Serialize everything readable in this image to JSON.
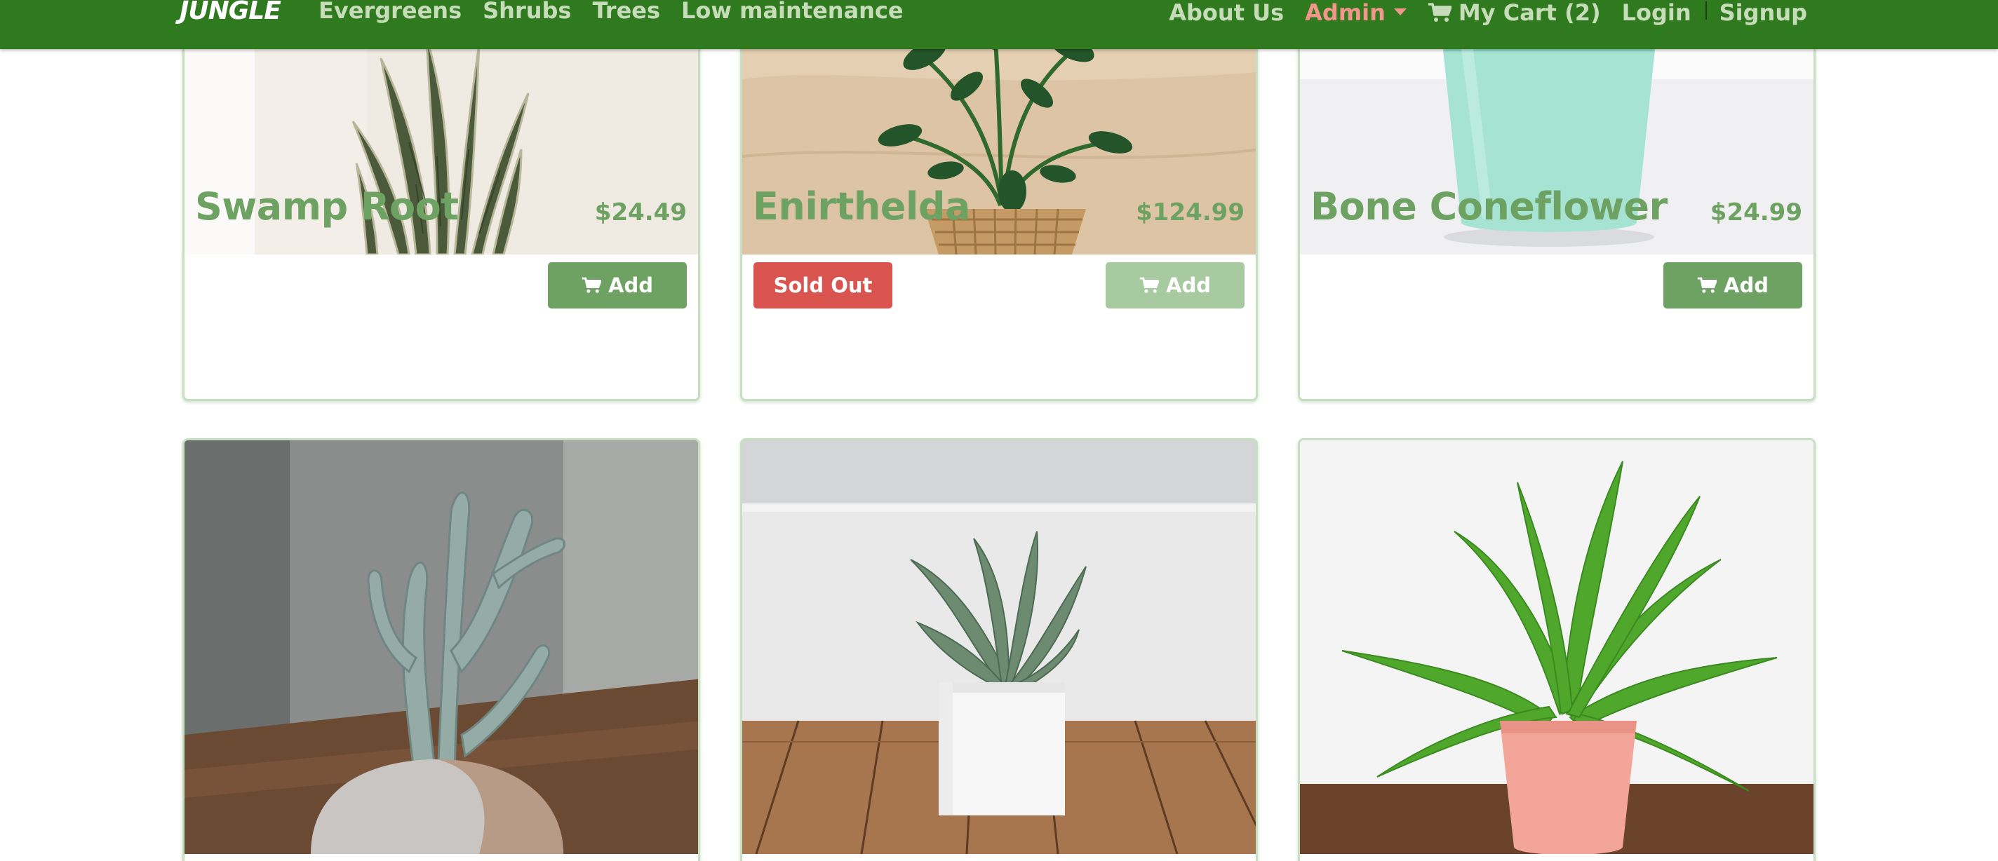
{
  "navbar": {
    "brand": "JUNGLE",
    "categories": [
      "Evergreens",
      "Shrubs",
      "Trees",
      "Low maintenance"
    ],
    "about": "About Us",
    "admin": "Admin",
    "cart": "My Cart (2)",
    "login": "Login",
    "signup": "Signup",
    "cart_icon": "shopping-cart-icon",
    "admin_icon": "caret-down-icon"
  },
  "products": [
    {
      "name": "Swamp Root",
      "price": "$24.49",
      "add_label": "Add",
      "sold_out": false,
      "image": "snake-plant-photo"
    },
    {
      "name": "Enirthelda",
      "price": "$124.99",
      "add_label": "Add",
      "sold_out": true,
      "sold_out_label": "Sold Out",
      "image": "peperomia-wicker-pot-photo"
    },
    {
      "name": "Bone Coneflower",
      "price": "$24.99",
      "add_label": "Add",
      "sold_out": false,
      "image": "mint-pot-photo"
    },
    {
      "image": "cactus-grey-pot-photo"
    },
    {
      "image": "succulent-white-pot-photo"
    },
    {
      "image": "fern-pink-pot-photo"
    }
  ],
  "colors": {
    "navbar": "#2f7a1f",
    "nav_link": "#c7dcb9",
    "admin_link": "#f2958a",
    "product_text": "#6ea262",
    "add_button": "#6ea262",
    "add_button_disabled": "#a8caa0",
    "sold_out": "#d9534f",
    "card_border": "#c6dfc1"
  }
}
